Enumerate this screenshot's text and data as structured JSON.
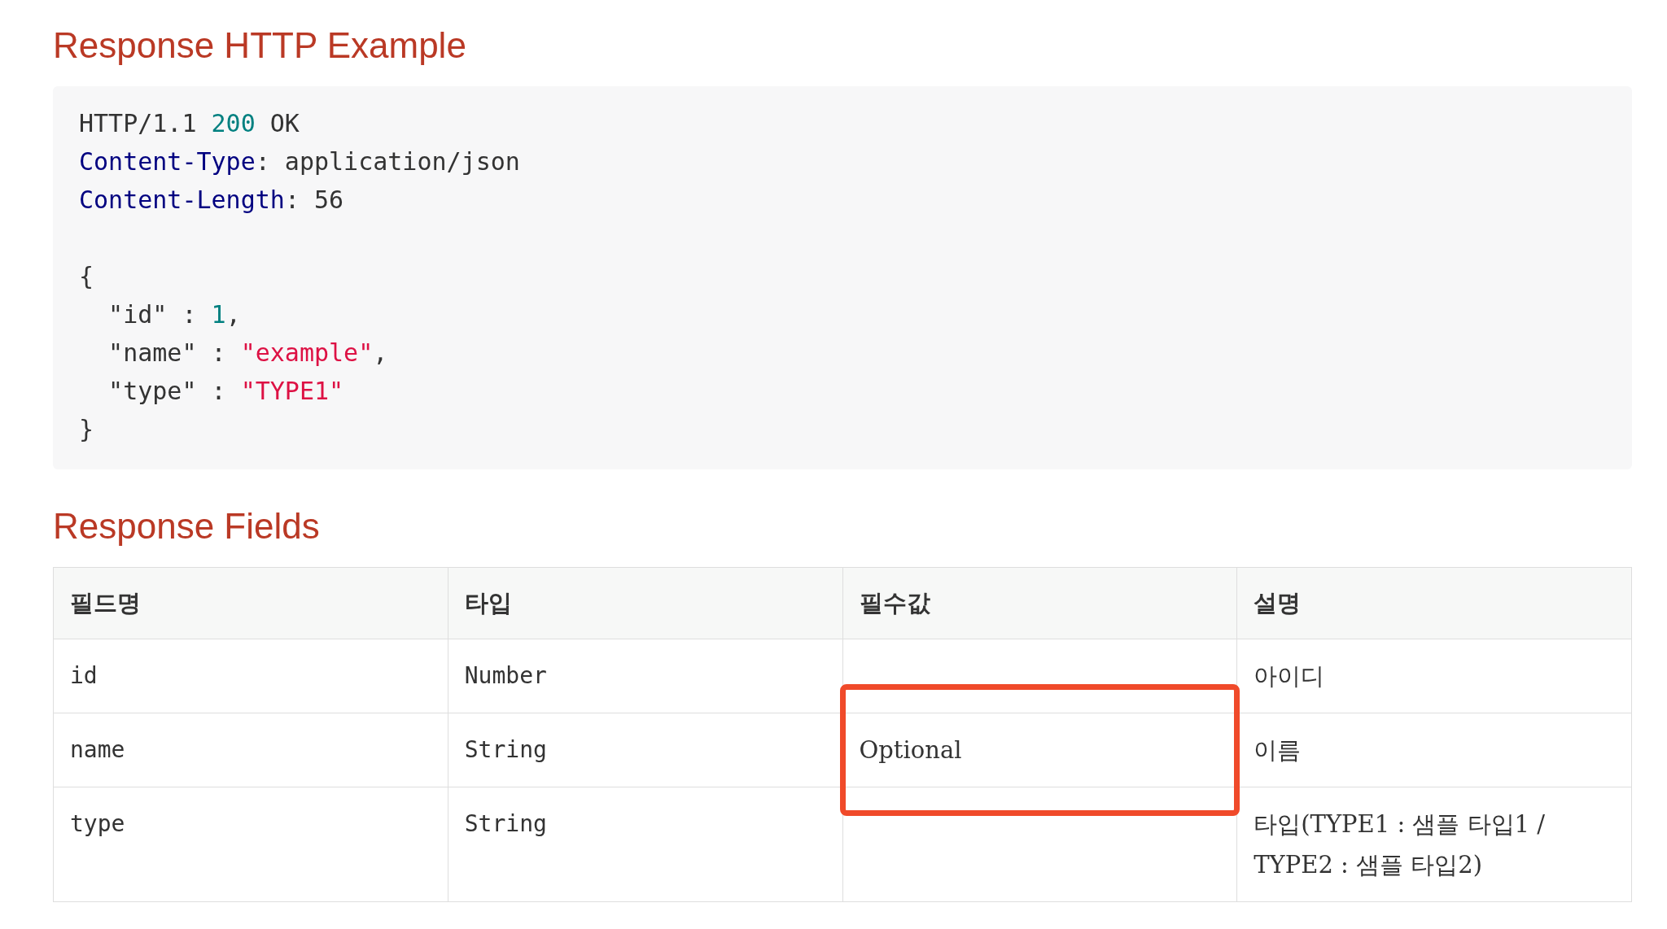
{
  "sections": [
    {
      "heading": "Response HTTP Example",
      "kind": "code",
      "code": {
        "headers": [
          [
            {
              "text": "HTTP/1.1 ",
              "kind": "plain"
            },
            {
              "text": "200",
              "kind": "number"
            },
            {
              "text": " OK",
              "kind": "plain"
            }
          ],
          [
            {
              "text": "Content-Type",
              "kind": "key"
            },
            {
              "text": ": application/json",
              "kind": "plain"
            }
          ],
          [
            {
              "text": "Content-Length",
              "kind": "key"
            },
            {
              "text": ": 56",
              "kind": "plain"
            }
          ]
        ],
        "body": [
          [
            {
              "text": "{",
              "kind": "plain"
            }
          ],
          [
            {
              "text": "  \"id\" : ",
              "kind": "plain"
            },
            {
              "text": "1",
              "kind": "number"
            },
            {
              "text": ",",
              "kind": "plain"
            }
          ],
          [
            {
              "text": "  \"name\" : ",
              "kind": "plain"
            },
            {
              "text": "\"example\"",
              "kind": "string"
            },
            {
              "text": ",",
              "kind": "plain"
            }
          ],
          [
            {
              "text": "  \"type\" : ",
              "kind": "plain"
            },
            {
              "text": "\"TYPE1\"",
              "kind": "string"
            }
          ],
          [
            {
              "text": "}",
              "kind": "plain"
            }
          ]
        ]
      }
    },
    {
      "heading": "Response Fields",
      "kind": "table",
      "table": {
        "columns": [
          {
            "label": "필드명",
            "kind": "code"
          },
          {
            "label": "타입",
            "kind": "code"
          },
          {
            "label": "필수값",
            "kind": "text"
          },
          {
            "label": "설명",
            "kind": "text"
          }
        ],
        "rows": [
          {
            "cells": [
              {
                "text": "id",
                "highlighted": false
              },
              {
                "text": "Number",
                "highlighted": false
              },
              {
                "highlighted": false
              },
              {
                "text": "아이디",
                "highlighted": false
              }
            ]
          },
          {
            "cells": [
              {
                "text": "name",
                "highlighted": false
              },
              {
                "text": "String",
                "highlighted": false
              },
              {
                "text": "Optional",
                "highlighted": true
              },
              {
                "text": "이름",
                "highlighted": false
              }
            ]
          },
          {
            "cells": [
              {
                "text": "type",
                "highlighted": false
              },
              {
                "text": "String",
                "highlighted": false
              },
              {
                "highlighted": false
              },
              {
                "text": "타입(TYPE1 : 샘플 타입1 / TYPE2 : 샘플 타입2)",
                "highlighted": false
              }
            ]
          }
        ]
      }
    }
  ]
}
